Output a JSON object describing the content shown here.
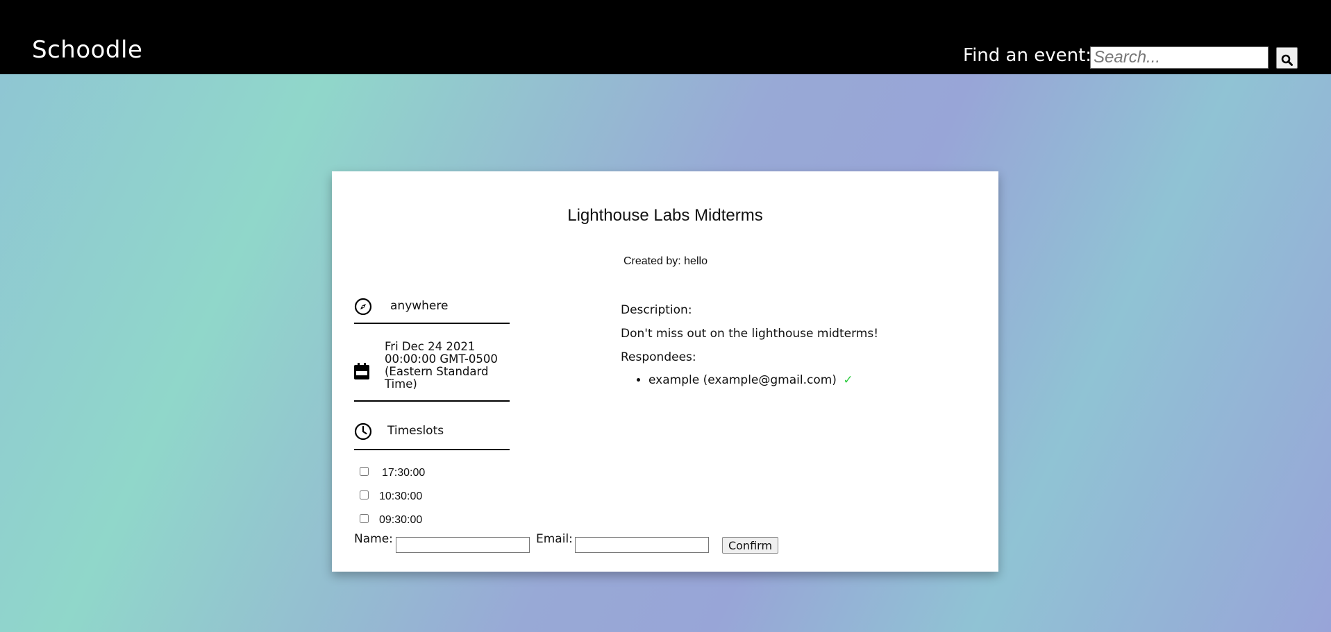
{
  "header": {
    "brand": "Schoodle",
    "search_label": "Find an event:",
    "search_placeholder": "Search...",
    "search_icon": "search-icon"
  },
  "event": {
    "title": "Lighthouse Labs Midterms",
    "creator": "Created by: hello",
    "location": "anywhere",
    "location_icon": "compass-icon",
    "date": "Fri Dec 24 2021 00:00:00 GMT-0500 (Eastern Standard Time)",
    "date_icon": "calendar-icon",
    "timeslots_label": "Timeslots",
    "timeslots_icon": "clock-icon",
    "timeslots": [
      {
        "time": "17:30:00",
        "checked": false
      },
      {
        "time": "10:30:00",
        "checked": false
      },
      {
        "time": "09:30:00",
        "checked": false
      }
    ],
    "description_label": "Description:",
    "description": "Don't miss out on the lighthouse midterms!",
    "respondees_label": "Respondees:",
    "respondees": [
      {
        "text": "example (example@gmail.com)",
        "check": "✓",
        "check_color": "#2ecc40"
      }
    ]
  },
  "form": {
    "name_label": "Name:",
    "name_value": "",
    "email_label": "Email:",
    "email_value": "",
    "confirm_label": "Confirm"
  },
  "colors": {
    "header_bg": "#000000",
    "card_bg": "#ffffff",
    "gradient_teal": "#90d7ca",
    "gradient_lavender": "#98a5d7"
  }
}
